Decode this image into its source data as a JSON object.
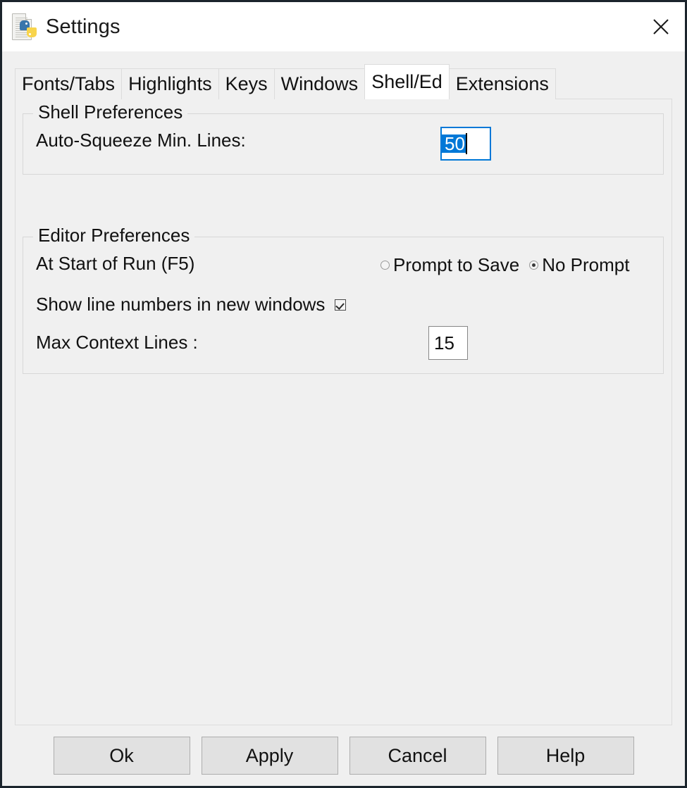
{
  "window": {
    "title": "Settings",
    "icon": "python-document-icon",
    "close_label": "×"
  },
  "tabs": [
    {
      "label": "Fonts/Tabs",
      "selected": false
    },
    {
      "label": "Highlights",
      "selected": false
    },
    {
      "label": "Keys",
      "selected": false
    },
    {
      "label": "Windows",
      "selected": false
    },
    {
      "label": "Shell/Ed",
      "selected": true
    },
    {
      "label": "Extensions",
      "selected": false
    }
  ],
  "shell_preferences": {
    "title": "Shell Preferences",
    "auto_squeeze": {
      "label": "Auto-Squeeze Min. Lines:",
      "value": "50",
      "selected": true,
      "focused": true
    }
  },
  "editor_preferences": {
    "title": "Editor Preferences",
    "at_start_of_run": {
      "label": "At Start of Run (F5)",
      "options": [
        {
          "label": "Prompt to Save",
          "checked": false
        },
        {
          "label": "No Prompt",
          "checked": true
        }
      ]
    },
    "line_numbers": {
      "label": "Show line numbers in new windows",
      "checked": true
    },
    "max_context_lines": {
      "label": "Max Context Lines :",
      "value": "15"
    }
  },
  "buttons": [
    {
      "label": "Ok"
    },
    {
      "label": "Apply"
    },
    {
      "label": "Cancel"
    },
    {
      "label": "Help"
    }
  ],
  "colors": {
    "window_background": "#f0f0f0",
    "titlebar_background": "#ffffff",
    "accent_selection": "#0078d7",
    "border": "#dcdcdc",
    "button_face": "#e1e1e1",
    "frame": "#1b242c"
  }
}
